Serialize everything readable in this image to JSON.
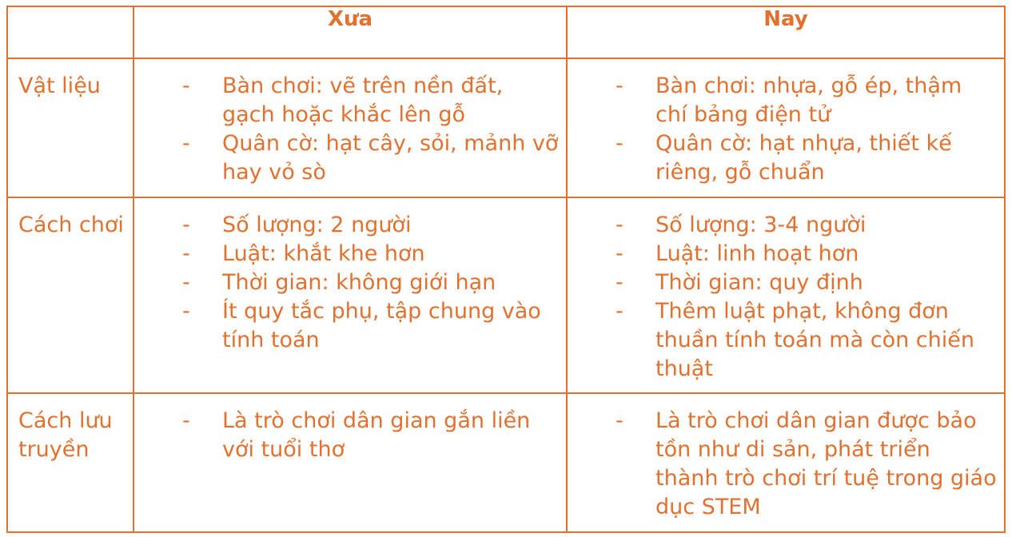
{
  "table": {
    "headers": [
      "",
      "Xưa",
      "Nay"
    ],
    "rows": [
      {
        "label": "Vật liệu",
        "old": [
          "Bàn chơi: vẽ trên nền đất, gạch hoặc khắc lên gỗ",
          "Quân cờ: hạt cây, sỏi, mảnh vỡ hay vỏ sò"
        ],
        "new": [
          "Bàn chơi: nhựa, gỗ ép, thậm chí bảng điện tử",
          "Quân cờ: hạt nhựa, thiết kế riêng, gỗ chuẩn"
        ]
      },
      {
        "label": "Cách chơi",
        "old": [
          "Số lượng: 2 người",
          "Luật: khắt khe hơn",
          "Thời gian: không giới hạn",
          "Ít quy tắc phụ, tập chung vào tính toán"
        ],
        "new": [
          "Số lượng: 3-4 người",
          "Luật: linh hoạt hơn",
          "Thời gian: quy định",
          "Thêm luật phạt, không đơn thuần tính toán mà còn chiến thuật"
        ]
      },
      {
        "label": "Cách lưu truyền",
        "old": [
          "Là trò chơi dân gian gắn liền với tuổi thơ"
        ],
        "new": [
          "Là trò chơi dân gian được bảo tồn như di sản, phát triển thành trò chơi trí tuệ trong giáo dục STEM"
        ]
      }
    ],
    "bullet": "-"
  },
  "colors": {
    "accent": "#e2712f",
    "background": "#ffffff"
  }
}
